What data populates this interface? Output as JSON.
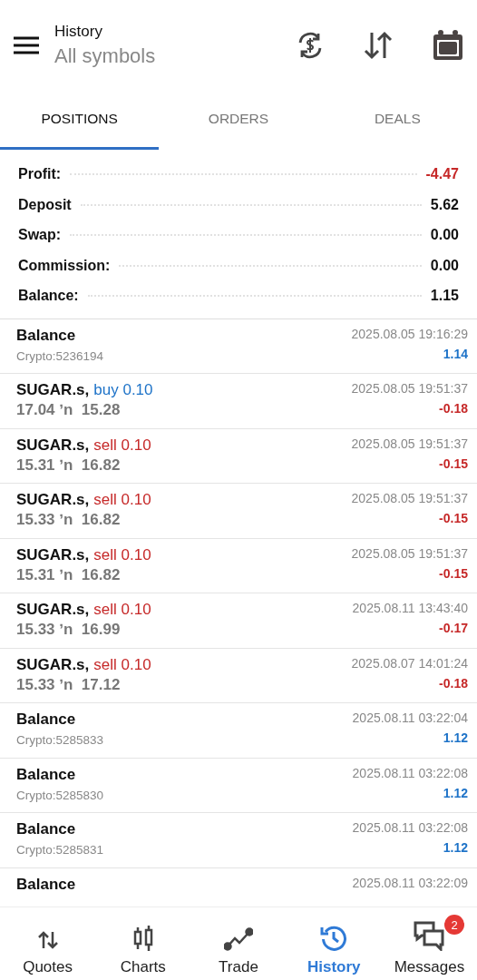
{
  "header": {
    "title": "History",
    "subtitle": "All symbols"
  },
  "tabs": [
    {
      "label": "POSITIONS",
      "selected": true
    },
    {
      "label": "ORDERS",
      "selected": false
    },
    {
      "label": "DEALS",
      "selected": false
    }
  ],
  "summary": [
    {
      "label": "Profit:",
      "value": "-4.47",
      "color": "#c62828"
    },
    {
      "label": "Deposit",
      "value": "5.62",
      "color": "#111111"
    },
    {
      "label": "Swap:",
      "value": "0.00",
      "color": "#111111"
    },
    {
      "label": "Commission:",
      "value": "0.00",
      "color": "#111111"
    },
    {
      "label": "Balance:",
      "value": "1.15",
      "color": "#111111"
    }
  ],
  "rows": [
    {
      "kind": "balance",
      "title": "Balance",
      "detail": "Crypto:5236194",
      "time": "2025.08.05 19:16:29",
      "amount": "1.14",
      "color": "#1e73c8"
    },
    {
      "kind": "trade",
      "title": "SUGAR.s,",
      "order": {
        "text": "buy 0.10",
        "color": "#1e73c8"
      },
      "prices": "17.04 ʼn  15.28",
      "time": "2025.08.05 19:51:37",
      "amount": "-0.18",
      "color": "#c62828"
    },
    {
      "kind": "trade",
      "title": "SUGAR.s,",
      "order": {
        "text": "sell 0.10",
        "color": "#c62828"
      },
      "prices": "15.31 ʼn  16.82",
      "time": "2025.08.05 19:51:37",
      "amount": "-0.15",
      "color": "#c62828"
    },
    {
      "kind": "trade",
      "title": "SUGAR.s,",
      "order": {
        "text": "sell 0.10",
        "color": "#c62828"
      },
      "prices": "15.33 ʼn  16.82",
      "time": "2025.08.05 19:51:37",
      "amount": "-0.15",
      "color": "#c62828"
    },
    {
      "kind": "trade",
      "title": "SUGAR.s,",
      "order": {
        "text": "sell 0.10",
        "color": "#c62828"
      },
      "prices": "15.31 ʼn  16.82",
      "time": "2025.08.05 19:51:37",
      "amount": "-0.15",
      "color": "#c62828"
    },
    {
      "kind": "trade",
      "title": "SUGAR.s,",
      "order": {
        "text": "sell 0.10",
        "color": "#c62828"
      },
      "prices": "15.33 ʼn  16.99",
      "time": "2025.08.11 13:43:40",
      "amount": "-0.17",
      "color": "#c62828"
    },
    {
      "kind": "trade",
      "title": "SUGAR.s,",
      "order": {
        "text": "sell 0.10",
        "color": "#c62828"
      },
      "prices": "15.33 ʼn  17.12",
      "time": "2025.08.07 14:01:24",
      "amount": "-0.18",
      "color": "#c62828"
    },
    {
      "kind": "balance",
      "title": "Balance",
      "detail": "Crypto:5285833",
      "time": "2025.08.11 03:22:04",
      "amount": "1.12",
      "color": "#1e73c8"
    },
    {
      "kind": "balance",
      "title": "Balance",
      "detail": "Crypto:5285830",
      "time": "2025.08.11 03:22:08",
      "amount": "1.12",
      "color": "#1e73c8"
    },
    {
      "kind": "balance",
      "title": "Balance",
      "detail": "Crypto:5285831",
      "time": "2025.08.11 03:22:08",
      "amount": "1.12",
      "color": "#1e73c8"
    },
    {
      "kind": "balance",
      "title": "Balance",
      "time": "2025.08.11 03:22:09"
    }
  ],
  "nav": [
    {
      "label": "Quotes",
      "kind": "quotes",
      "selected": false
    },
    {
      "label": "Charts",
      "kind": "charts",
      "selected": false
    },
    {
      "label": "Trade",
      "kind": "trade",
      "selected": false
    },
    {
      "label": "History",
      "kind": "history",
      "selected": true
    },
    {
      "label": "Messages",
      "kind": "messages",
      "selected": false,
      "badge": "2"
    }
  ]
}
